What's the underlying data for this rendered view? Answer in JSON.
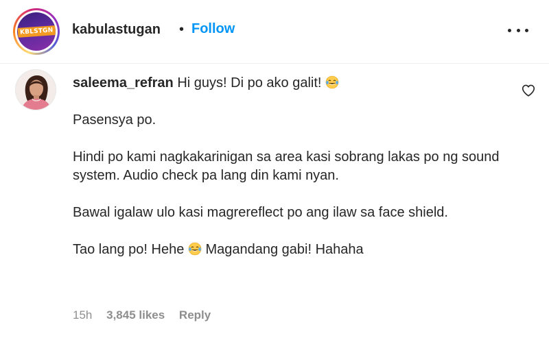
{
  "header": {
    "logo_text": "KBLSTGN",
    "username": "kabulastugan",
    "separator": "•",
    "follow_label": "Follow",
    "more_icon": "more-options-icon"
  },
  "comment": {
    "username": "saleema_refran",
    "line1": "Hi guys! Di po ako galit!",
    "p2": "Pasensya po.",
    "p3": "Hindi po kami nagkakarinigan sa area kasi sobrang lakas po ng sound system. Audio check pa lang din kami nyan.",
    "p4": "Bawal igalaw ulo kasi magrereflect po ang ilaw sa face shield.",
    "p5_a": "Tao lang po! Hehe",
    "p5_b": "Magandang gabi! Hahaha",
    "emoji_icon": "laughing-crying-emoji",
    "time": "15h",
    "likes": "3,845 likes",
    "reply_label": "Reply",
    "like_icon": "heart-outline-icon"
  },
  "colors": {
    "follow_blue": "#0095f6",
    "text_dark": "#262626",
    "meta_gray": "#8e8e8e",
    "logo_badge": "#f39a22",
    "logo_bg": "#5b2a9e"
  }
}
